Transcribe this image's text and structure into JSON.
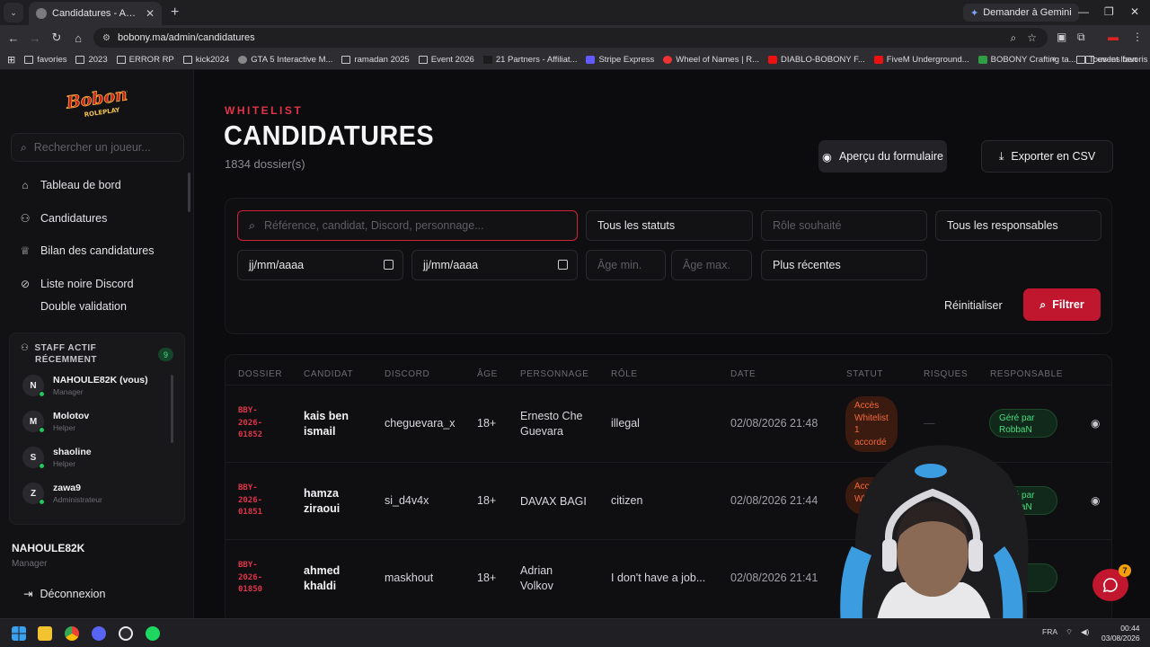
{
  "browser": {
    "tab_title": "Candidatures - Administration B",
    "url": "bobony.ma/admin/candidatures",
    "gemini_label": "Demander à Gemini",
    "bookmarks": [
      "favories",
      "2023",
      "ERROR RP",
      "kick2024",
      "GTA 5 Interactive M...",
      "ramadan 2025",
      "Event 2026",
      "21 Partners - Affiliat...",
      "Stripe Express",
      "Wheel of Names | R...",
      "DIABLO-BOBONY F...",
      "FiveM Underground...",
      "BOBONY Crafting ta...",
      "event lben"
    ],
    "all_bookmarks": "Tous les favoris"
  },
  "sidebar": {
    "logo_text": "Bobony",
    "logo_sub": "ROLEPLAY",
    "search_placeholder": "Rechercher un joueur...",
    "items": [
      {
        "label": "Tableau de bord"
      },
      {
        "label": "Candidatures"
      },
      {
        "label": "Bilan des candidatures"
      },
      {
        "label": "Liste noire Discord"
      },
      {
        "label": "Double validation"
      }
    ],
    "staff_title_1": "STAFF ACTIF",
    "staff_title_2": "RÉCEMMENT",
    "staff_count": "9",
    "staff": [
      {
        "initial": "N",
        "name": "NAHOULE82K (vous)",
        "role": "Manager"
      },
      {
        "initial": "M",
        "name": "Molotov",
        "role": "Helper"
      },
      {
        "initial": "S",
        "name": "shaoline",
        "role": "Helper"
      },
      {
        "initial": "Z",
        "name": "zawa9",
        "role": "Administrateur"
      }
    ],
    "user_name": "NAHOULE82K",
    "user_role": "Manager",
    "logout": "Déconnexion"
  },
  "header": {
    "eyebrow": "WHITELIST",
    "title": "CANDIDATURES",
    "count": "1834 dossier(s)",
    "preview_btn": "Aperçu du formulaire",
    "export_btn": "Exporter en CSV"
  },
  "filters": {
    "search_placeholder": "Référence, candidat, Discord, personnage...",
    "status": "Tous les statuts",
    "role_placeholder": "Rôle souhaité",
    "responsables": "Tous les responsables",
    "date_from": "jj/mm/aaaa",
    "date_to": "jj/mm/aaaa",
    "age_min": "Âge min.",
    "age_max": "Âge max.",
    "sort": "Plus récentes",
    "reset": "Réinitialiser",
    "apply": "Filtrer"
  },
  "table": {
    "headers": [
      "DOSSIER",
      "CANDIDAT",
      "DISCORD",
      "ÂGE",
      "PERSONNAGE",
      "RÔLE",
      "DATE",
      "STATUT",
      "RISQUES",
      "RESPONSABLE"
    ],
    "rows": [
      {
        "ref1": "BBY-",
        "ref2": "2026-",
        "ref3": "01852",
        "cand1": "kais ben",
        "cand2": "ismail",
        "discord": "cheguevara_x",
        "age": "18+",
        "perso1": "Ernesto Che",
        "perso2": "Guevara",
        "role": "illegal",
        "date": "02/08/2026 21:48",
        "status1": "Accès",
        "status2": "Whitelist",
        "status3": "1",
        "status4": "accordé",
        "risk": "—",
        "resp1": "Géré par",
        "resp2": "RobbaN"
      },
      {
        "ref1": "BBY-",
        "ref2": "2026-",
        "ref3": "01851",
        "cand1": "hamza",
        "cand2": "ziraoui",
        "discord": "si_d4v4x",
        "age": "18+",
        "perso1": "DAVAX BAGI",
        "perso2": "",
        "role": "citizen",
        "date": "02/08/2026 21:44",
        "status1": "Accès",
        "status2": "Wh",
        "status3": "",
        "status4": "",
        "risk": "",
        "resp1": "Géré par",
        "resp2": "RobbaN"
      },
      {
        "ref1": "BBY-",
        "ref2": "2026-",
        "ref3": "01850",
        "cand1": "ahmed",
        "cand2": "khaldi",
        "discord": "maskhout",
        "age": "18+",
        "perso1": "Adrian",
        "perso2": "Volkov",
        "role": "I don't have a job...",
        "date": "02/08/2026 21:41",
        "status1": "",
        "status2": "",
        "status3": "",
        "status4": "",
        "risk": "",
        "resp1": "",
        "resp2": "baN"
      }
    ]
  },
  "chat_badge": "7",
  "taskbar": {
    "lang": "FRA",
    "time": "00:44",
    "date": "03/08/2026"
  }
}
